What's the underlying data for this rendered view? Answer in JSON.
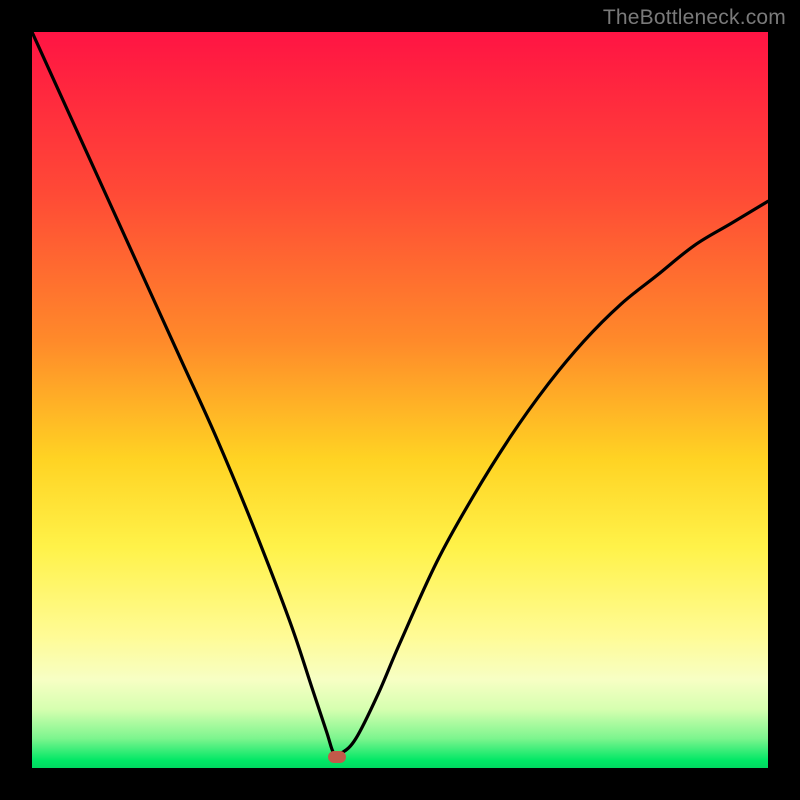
{
  "watermark": "TheBottleneck.com",
  "colors": {
    "frame": "#000000",
    "curve": "#000000",
    "marker": "#c25a4a",
    "gradient_top": "#ff1444",
    "gradient_bottom": "#00d860"
  },
  "chart_data": {
    "type": "line",
    "title": "",
    "xlabel": "",
    "ylabel": "",
    "xlim": [
      0,
      100
    ],
    "ylim": [
      0,
      100
    ],
    "grid": false,
    "legend": false,
    "note": "Axes are unlabeled; values are normalized 0–100 estimated from pixel positions. y=0 is bottom (green), y=100 is top (red).",
    "series": [
      {
        "name": "bottleneck-curve",
        "x": [
          0,
          5,
          10,
          15,
          20,
          25,
          30,
          35,
          38,
          40,
          41,
          42,
          44,
          47,
          50,
          55,
          60,
          65,
          70,
          75,
          80,
          85,
          90,
          95,
          100
        ],
        "y": [
          100,
          89,
          78,
          67,
          56,
          45,
          33,
          20,
          11,
          5,
          2,
          2,
          4,
          10,
          17,
          28,
          37,
          45,
          52,
          58,
          63,
          67,
          71,
          74,
          77
        ]
      }
    ],
    "marker": {
      "x": 41.5,
      "y": 1.5,
      "shape": "rounded-rect"
    }
  }
}
